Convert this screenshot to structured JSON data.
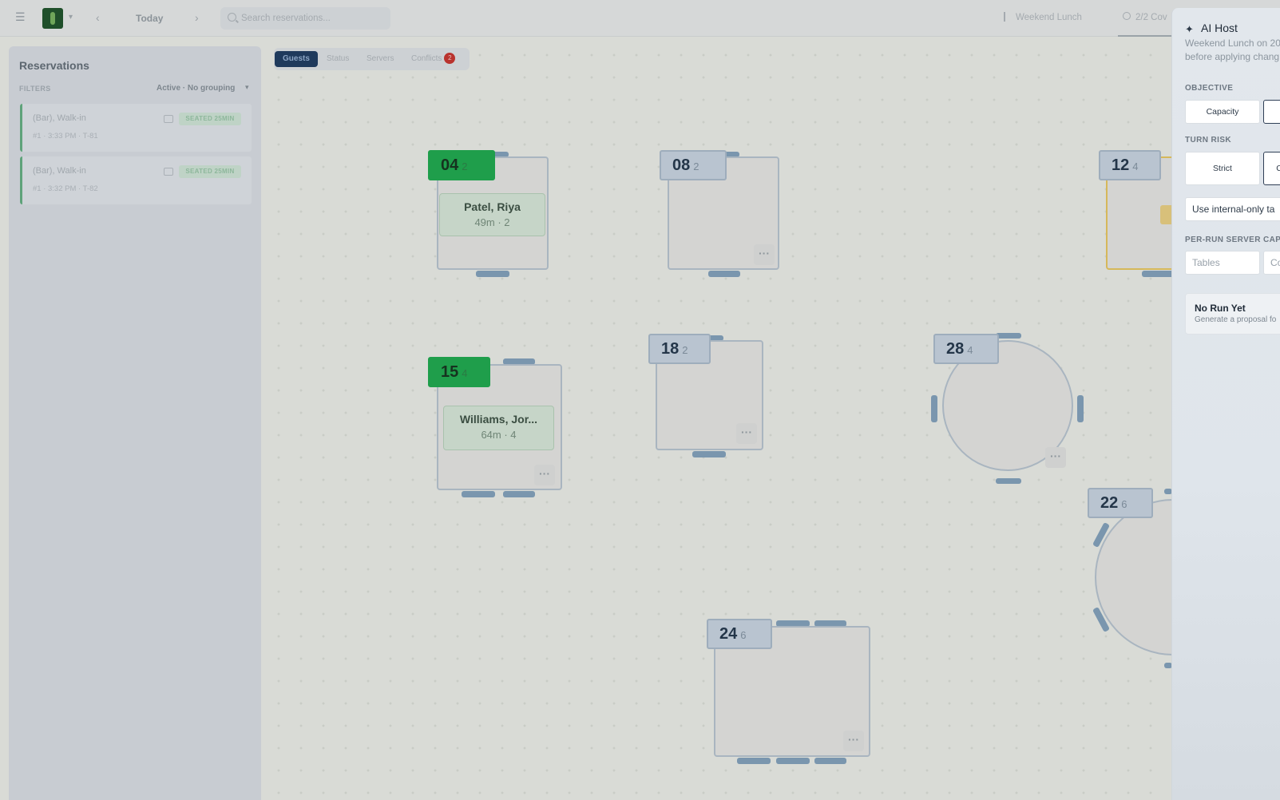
{
  "topbar": {
    "date_label": "Today",
    "search_placeholder": "Search reservations...",
    "service_label": "Weekend Lunch",
    "covers_label": "2/2 Cov"
  },
  "sidebar": {
    "title": "Reservations",
    "filters_label": "FILTERS",
    "filter_value": "Active · No grouping",
    "reservations": [
      {
        "name": "(Bar), Walk-in",
        "meta": "#1  ·  3:33 PM  ·  T-81",
        "status": "SEATED 25MIN"
      },
      {
        "name": "(Bar), Walk-in",
        "meta": "#1  ·  3:32 PM  ·  T-82",
        "status": "SEATED 25MIN"
      }
    ]
  },
  "view_tabs": {
    "guests": "Guests",
    "status": "Status",
    "servers": "Servers",
    "conflicts": "Conflicts",
    "conflicts_count": "2"
  },
  "tables": [
    {
      "number": "04",
      "capacity": "2",
      "state": "occupied",
      "guest": "Patel, Riya",
      "guest_meta": "49m · 2"
    },
    {
      "number": "08",
      "capacity": "2",
      "state": "open"
    },
    {
      "number": "12",
      "capacity": "4",
      "state": "warning"
    },
    {
      "number": "15",
      "capacity": "4",
      "state": "occupied",
      "guest": "Williams, Jor...",
      "guest_meta": "64m · 4"
    },
    {
      "number": "18",
      "capacity": "2",
      "state": "open"
    },
    {
      "number": "28",
      "capacity": "4",
      "state": "open"
    },
    {
      "number": "22",
      "capacity": "6",
      "state": "open"
    },
    {
      "number": "24",
      "capacity": "6",
      "state": "open"
    }
  ],
  "more_label": "···",
  "ai_host": {
    "title": "AI Host",
    "subtitle_line1": "Weekend Lunch on 20",
    "subtitle_line2": "before applying chang",
    "objective_label": "OBJECTIVE",
    "objective_options": [
      "Capacity",
      ""
    ],
    "turn_risk_label": "TURN RISK",
    "turn_risk_options": [
      "Strict",
      "C"
    ],
    "internal_toggle": "Use internal-only ta",
    "server_cap_label": "PER-RUN SERVER CAP",
    "tables_placeholder": "Tables",
    "covers_placeholder": "Co",
    "no_run_title": "No Run Yet",
    "no_run_subtitle": "Generate a proposal fo"
  },
  "colors": {
    "occupied_green": "#1f9e4b",
    "warning_yellow": "#d6b85a",
    "primary_navy": "#1f3a5c",
    "conflict_red": "#b9332e"
  }
}
